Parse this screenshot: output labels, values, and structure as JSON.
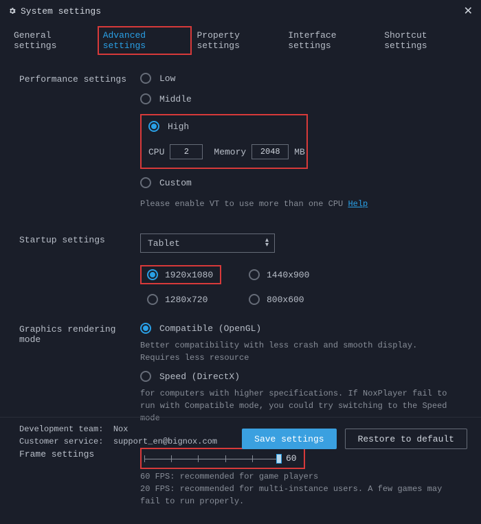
{
  "title": "System settings",
  "tabs": [
    {
      "label": "General settings"
    },
    {
      "label": "Advanced settings"
    },
    {
      "label": "Property settings"
    },
    {
      "label": "Interface settings"
    },
    {
      "label": "Shortcut settings"
    }
  ],
  "performance": {
    "section_label": "Performance settings",
    "low": "Low",
    "middle": "Middle",
    "high": "High",
    "custom": "Custom",
    "cpu_label": "CPU",
    "cpu_value": "2",
    "memory_label": "Memory",
    "memory_value": "2048",
    "memory_unit": "MB",
    "vt_text": "Please enable VT to use more than one CPU ",
    "vt_link": "Help"
  },
  "startup": {
    "section_label": "Startup settings",
    "select_value": "Tablet",
    "res_1920": "1920x1080",
    "res_1440": "1440x900",
    "res_1280": "1280x720",
    "res_800": "800x600"
  },
  "graphics": {
    "section_label": "Graphics rendering mode",
    "compatible": "Compatible (OpenGL)",
    "compatible_desc": "Better compatibility with less crash and smooth display. Requires less resource",
    "speed": "Speed (DirectX)",
    "speed_desc": "for computers with higher specifications. If NoxPlayer fail to run with Compatible mode, you could try switching to the Speed mode"
  },
  "frame": {
    "section_label": "Frame settings",
    "value": "60",
    "desc": "60 FPS: recommended for game players\n20 FPS: recommended for multi-instance users. A few games may fail to run properly."
  },
  "footer": {
    "dev_label": "Development team",
    "dev_value": "Nox",
    "cs_label": "Customer service",
    "cs_value": "support_en@bignox.com",
    "save": "Save settings",
    "restore": "Restore to default"
  }
}
